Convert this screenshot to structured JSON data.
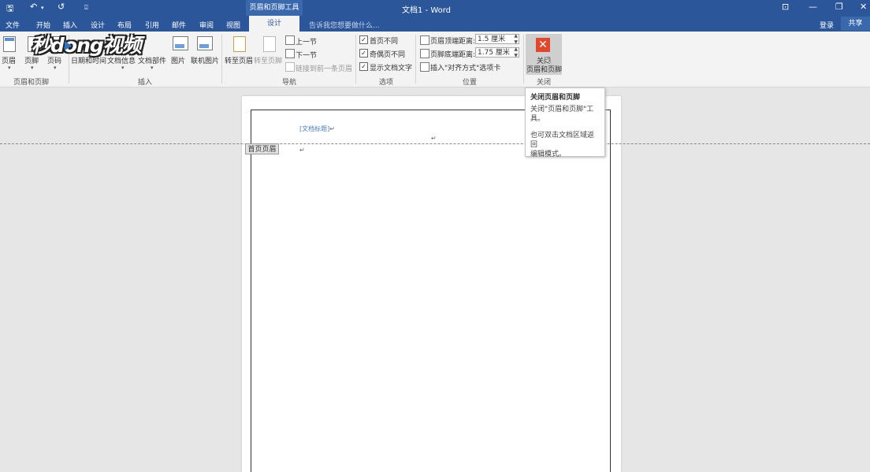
{
  "titlebar": {
    "qat": {
      "save": "🖫",
      "undo": "↶",
      "undo_caret": "▾",
      "redo": "↺",
      "customize": "⍗"
    },
    "context_title": "页眉和页脚工具",
    "doc_title": "文档1 - Word",
    "window": {
      "ribbon_opts": "⊡",
      "minimize": "—",
      "restore": "❐",
      "close": "✕"
    }
  },
  "tabs": [
    "文件",
    "开始",
    "插入",
    "设计",
    "布局",
    "引用",
    "邮件",
    "审阅",
    "视图"
  ],
  "active_tab": "设计",
  "tell_me": "告诉我您想要做什么...",
  "login": "登录",
  "share": "共享",
  "logo_text": "秒dong视频",
  "ribbon": {
    "group1": {
      "label": "页眉和页脚",
      "buttons": [
        "页眉",
        "页脚",
        "页码"
      ]
    },
    "group2": {
      "label": "插入",
      "buttons": [
        "日期和时间",
        "文档信息",
        "文档部件",
        "图片",
        "联机图片"
      ]
    },
    "group3": {
      "label": "导航",
      "goto_header": "转至页眉",
      "goto_footer": "转至页脚",
      "prev": "上一节",
      "next": "下一节",
      "link_prev": "链接到前一条页眉"
    },
    "group4": {
      "label": "选项",
      "options": [
        {
          "label": "首页不同",
          "checked": true
        },
        {
          "label": "奇偶页不同",
          "checked": true
        },
        {
          "label": "显示文档文字",
          "checked": true
        }
      ]
    },
    "group5": {
      "label": "位置",
      "header_dist_label": "页眉顶端距离:",
      "header_dist_value": "1.5 厘米",
      "footer_dist_label": "页脚底端距离:",
      "footer_dist_value": "1.75 厘米",
      "insert_align_tab": "插入\"对齐方式\"选项卡"
    },
    "group6": {
      "label": "关闭",
      "close_label_1": "关闭",
      "close_label_2": "页眉和页脚"
    }
  },
  "document": {
    "title_field": "[文档标题]",
    "header_tag": "首页页眉",
    "para_mark": "↵"
  },
  "tooltip": {
    "title": "关闭页眉和页脚",
    "line1": "关闭\"页眉和页脚\"工",
    "line2": "具。",
    "line3": "也可双击文档区域返回",
    "line4": "编辑模式。"
  },
  "colors": {
    "accent": "#2b579a",
    "close": "#e0472b",
    "title_field": "#4a7ec2"
  }
}
